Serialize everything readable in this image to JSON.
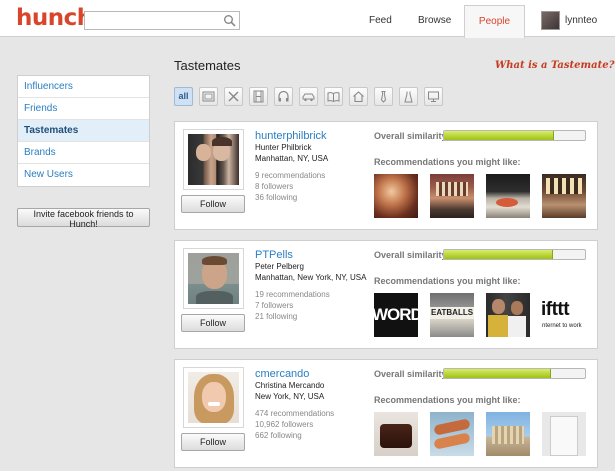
{
  "header": {
    "logo": "hunch",
    "search_placeholder": "",
    "nav": [
      {
        "label": "Feed"
      },
      {
        "label": "Browse"
      },
      {
        "label": "People"
      }
    ],
    "username": "lynnteo"
  },
  "sidebar": {
    "items": [
      {
        "label": "Influencers"
      },
      {
        "label": "Friends"
      },
      {
        "label": "Tastemates"
      },
      {
        "label": "Brands"
      },
      {
        "label": "New Users"
      }
    ],
    "invite_label": "Invite facebook friends to Hunch!"
  },
  "main": {
    "title": "Tastemates",
    "what_link": "What is a Tastemate?",
    "filter_all": "all",
    "filters": [
      "image-icon",
      "utensils-icon",
      "film-icon",
      "headphones-icon",
      "car-icon",
      "book-icon",
      "home-icon",
      "tie-icon",
      "dress-icon",
      "monitor-icon"
    ],
    "similarity_label": "Overall similarity:",
    "recs_label": "Recommendations you might like:",
    "follow_label": "Follow",
    "cards": [
      {
        "username": "hunterphilbrick",
        "full_name": "Hunter Philbrick",
        "location": "Manhattan, NY, USA",
        "recommendations": "9 recommendations",
        "followers": "8 followers",
        "following": "36 following",
        "similarity": 0.78
      },
      {
        "username": "PTPells",
        "full_name": "Peter Pelberg",
        "location": "Manhattan, New York, NY, USA",
        "recommendations": "19 recommendations",
        "followers": "7 followers",
        "following": "21 following",
        "similarity": 0.77,
        "thumb_texts": [
          "WORD",
          "EATBALLS",
          "",
          "ifttt",
          "nternet to work"
        ]
      },
      {
        "username": "cmercando",
        "full_name": "Christina Mercando",
        "location": "New York, NY, USA",
        "recommendations": "474 recommendations",
        "followers": "10,962 followers",
        "following": "662 following",
        "similarity": 0.76
      }
    ]
  },
  "colors": {
    "brand": "#d8452b",
    "link": "#2a7ec2",
    "bar_fill": "#9fc116"
  }
}
